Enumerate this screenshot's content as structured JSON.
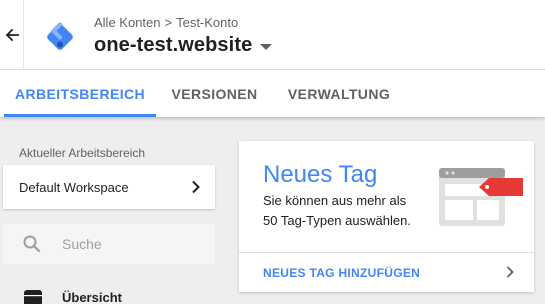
{
  "header": {
    "breadcrumb": [
      "Alle Konten",
      "Test-Konto"
    ],
    "breadcrumb_separator": ">",
    "title": "one-test.website"
  },
  "tabs": [
    {
      "label": "ARBEITSBEREICH",
      "active": true
    },
    {
      "label": "VERSIONEN",
      "active": false
    },
    {
      "label": "VERWALTUNG",
      "active": false
    }
  ],
  "sidebar": {
    "workspace_label": "Aktueller Arbeitsbereich",
    "workspace_name": "Default Workspace",
    "search_placeholder": "Suche",
    "nav": [
      {
        "label": "Übersicht",
        "icon": "overview-icon"
      }
    ]
  },
  "card": {
    "title": "Neues Tag",
    "description": "Sie können aus mehr als 50 Tag-Typen auswählen.",
    "action": "NEUES TAG HINZUFÜGEN"
  },
  "colors": {
    "accent": "#4285f4",
    "logo_blue": "#4285f4",
    "tag_red": "#e53935"
  },
  "icons": [
    "back-arrow-icon",
    "gtm-logo-icon",
    "dropdown-caret-icon",
    "chevron-right-icon",
    "search-icon",
    "overview-icon",
    "tag-illustration-icon"
  ]
}
